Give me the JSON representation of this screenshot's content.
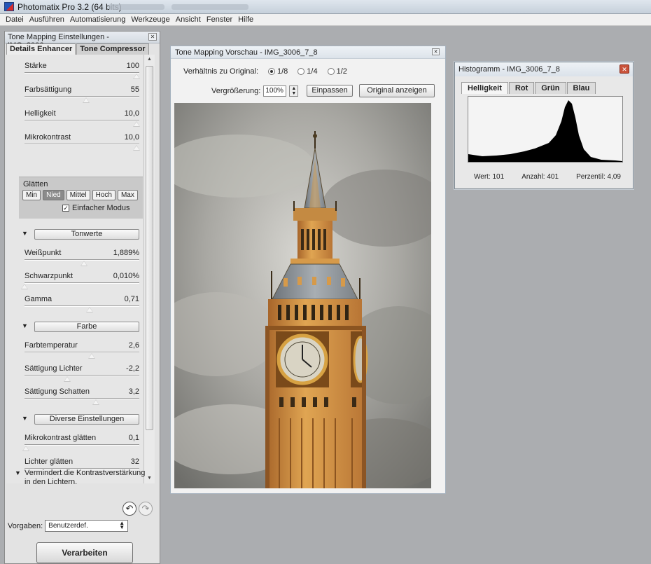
{
  "app": {
    "title": "Photomatix Pro 3.2 (64 bits)"
  },
  "menu": [
    "Datei",
    "Ausführen",
    "Automatisierung",
    "Werkzeuge",
    "Ansicht",
    "Fenster",
    "Hilfe"
  ],
  "left_panel": {
    "title": "Tone Mapping Einstellungen - IMG_3006_...",
    "tabs": [
      "Details Enhancer",
      "Tone Compressor"
    ],
    "active_tab": "Details Enhancer",
    "sliders_top": [
      {
        "label": "Stärke",
        "value": "100",
        "pos": 1.0
      },
      {
        "label": "Farbsättigung",
        "value": "55",
        "pos": 0.55
      },
      {
        "label": "Helligkeit",
        "value": "10,0",
        "pos": 1.0
      },
      {
        "label": "Mikrokontrast",
        "value": "10,0",
        "pos": 1.0
      }
    ],
    "smoothing": {
      "label": "Glätten",
      "buttons": [
        "Min",
        "Nied",
        "Mittel",
        "Hoch",
        "Max"
      ],
      "selected": "Nied",
      "simple_mode_label": "Einfacher Modus",
      "simple_mode_checked": true
    },
    "section_tone": "Tonwerte",
    "sliders_tone": [
      {
        "label": "Weißpunkt",
        "value": "1,889%",
        "pos": 0.53
      },
      {
        "label": "Schwarzpunkt",
        "value": "0,010%",
        "pos": 0.0
      },
      {
        "label": "Gamma",
        "value": "0,71",
        "pos": 0.58
      }
    ],
    "section_color": "Farbe",
    "sliders_color": [
      {
        "label": "Farbtemperatur",
        "value": "2,6",
        "pos": 0.6
      },
      {
        "label": "Sättigung Lichter",
        "value": "-2,2",
        "pos": 0.38
      },
      {
        "label": "Sättigung Schatten",
        "value": "3,2",
        "pos": 0.64
      }
    ],
    "section_misc": "Diverse Einstellungen",
    "sliders_misc": [
      {
        "label": "Mikrokontrast glätten",
        "value": "0,1",
        "pos": 0.01
      },
      {
        "label": "Lichter glätten",
        "value": "32",
        "pos": 0.32
      }
    ],
    "description": "Vermindert die Kontrastverstärkung in den Lichtern.",
    "presets_label": "Vorgaben:",
    "presets_value": "Benutzerdef.",
    "process_button": "Verarbeiten"
  },
  "preview": {
    "title": "Tone Mapping Vorschau - IMG_3006_7_8",
    "ratio_label": "Verhältnis zu Original:",
    "ratio_options": [
      "1/8",
      "1/4",
      "1/2"
    ],
    "ratio_selected": "1/8",
    "zoom_label": "Vergrößerung:",
    "zoom_value": "100%",
    "fit_button": "Einpassen",
    "original_button": "Original anzeigen"
  },
  "histogram": {
    "title": "Histogramm - IMG_3006_7_8",
    "tabs": [
      "Helligkeit",
      "Rot",
      "Grün",
      "Blau"
    ],
    "active_tab": "Helligkeit",
    "stats": {
      "value": "Wert: 101",
      "count": "Anzahl: 401",
      "percentile": "Perzentil: 4,09"
    }
  },
  "colors": {
    "titlebar": "#c6d0db",
    "panel": "#e3e3e3",
    "tower": "#d99a45",
    "sky": "#9b9b96"
  }
}
